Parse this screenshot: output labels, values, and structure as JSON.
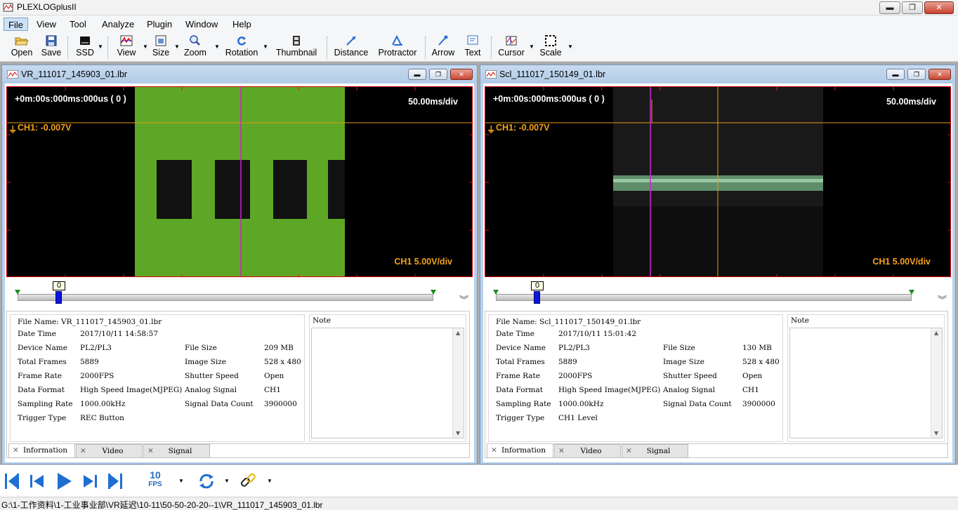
{
  "app": {
    "title": "PLEXLOGplusII",
    "window_buttons": {
      "minimize": "▬",
      "restore": "❐",
      "close": "✕"
    }
  },
  "menu": [
    "File",
    "View",
    "Tool",
    "Analyze",
    "Plugin",
    "Window",
    "Help"
  ],
  "toolbar": [
    {
      "label": "Open",
      "icon": "folder-open-icon"
    },
    {
      "label": "Save",
      "icon": "floppy-disk-icon"
    },
    {
      "label": "SSD",
      "icon": "ssd-drive-icon"
    },
    {
      "label": "View",
      "icon": "view-waveform-icon"
    },
    {
      "label": "Size",
      "icon": "size-icon"
    },
    {
      "label": "Zoom",
      "icon": "magnifier-icon"
    },
    {
      "label": "Rotation",
      "icon": "rotate-icon"
    },
    {
      "label": "Thumbnail",
      "icon": "film-strip-icon"
    },
    {
      "label": "Distance",
      "icon": "distance-icon"
    },
    {
      "label": "Protractor",
      "icon": "protractor-icon"
    },
    {
      "label": "Arrow",
      "icon": "arrow-icon"
    },
    {
      "label": "Text",
      "icon": "text-icon"
    },
    {
      "label": "Cursor",
      "icon": "cursor-icon"
    },
    {
      "label": "Scale",
      "icon": "scale-icon"
    }
  ],
  "windows": [
    {
      "title": "VR_111017_145903_01.lbr",
      "scope": {
        "timecode": "+0m:00s:000ms:000us ( 0 )",
        "time_div": "50.00ms/div",
        "ch_value": "CH1:  -0.007V",
        "ch_div": "CH1  5.00V/div"
      },
      "seek": {
        "position": "0"
      },
      "info": {
        "file_name": "File Name: VR_111017_145903_01.lbr",
        "rows": [
          {
            "k": "Date Time",
            "v": "2017/10/11 14:58:57",
            "k2": "",
            "v2": ""
          },
          {
            "k": "Device Name",
            "v": "PL2/PL3",
            "k2": "File Size",
            "v2": "209 MB"
          },
          {
            "k": "Total Frames",
            "v": "5889",
            "k2": "Image Size",
            "v2": "528 x 480"
          },
          {
            "k": "Frame Rate",
            "v": "2000FPS",
            "k2": "Shutter Speed",
            "v2": "Open"
          },
          {
            "k": "Data Format",
            "v": "High Speed Image(MJPEG)",
            "k2": "Analog Signal",
            "v2": "CH1"
          },
          {
            "k": "Sampling Rate",
            "v": "1000.00kHz",
            "k2": "Signal Data Count",
            "v2": "3900000"
          },
          {
            "k": "Trigger Type",
            "v": "REC Button",
            "k2": "",
            "v2": ""
          }
        ]
      }
    },
    {
      "title": "Scl_111017_150149_01.lbr",
      "scope": {
        "timecode": "+0m:00s:000ms:000us ( 0 )",
        "time_div": "50.00ms/div",
        "ch_value": "CH1:  -0.007V",
        "ch_div": "CH1  5.00V/div"
      },
      "seek": {
        "position": "0"
      },
      "info": {
        "file_name": "File Name: Scl_111017_150149_01.lbr",
        "rows": [
          {
            "k": "Date Time",
            "v": "2017/10/11 15:01:42",
            "k2": "",
            "v2": ""
          },
          {
            "k": "Device Name",
            "v": "PL2/PL3",
            "k2": "File Size",
            "v2": "130 MB"
          },
          {
            "k": "Total Frames",
            "v": "5889",
            "k2": "Image Size",
            "v2": "528 x 480"
          },
          {
            "k": "Frame Rate",
            "v": "2000FPS",
            "k2": "Shutter Speed",
            "v2": "Open"
          },
          {
            "k": "Data Format",
            "v": "High Speed Image(MJPEG)",
            "k2": "Analog Signal",
            "v2": "CH1"
          },
          {
            "k": "Sampling Rate",
            "v": "1000.00kHz",
            "k2": "Signal Data Count",
            "v2": "3900000"
          },
          {
            "k": "Trigger Type",
            "v": "CH1 Level",
            "k2": "",
            "v2": ""
          }
        ]
      }
    }
  ],
  "info_labels": {
    "note": "Note",
    "tabs": [
      "Information",
      "Video",
      "Signal"
    ]
  },
  "player": {
    "fps_value": "10",
    "fps_unit": "FPS"
  },
  "status": {
    "path": "G:\\1-工作资料\\1-工业事业部\\VR延迟\\10-11\\50-50-20-20--1\\VR_111017_145903_01.lbr"
  },
  "colors": {
    "accent": "#f5a31b",
    "scope_border": "#dd0000",
    "cursor_magenta": "#d020d0",
    "thumb_blue": "#0a16e0"
  }
}
